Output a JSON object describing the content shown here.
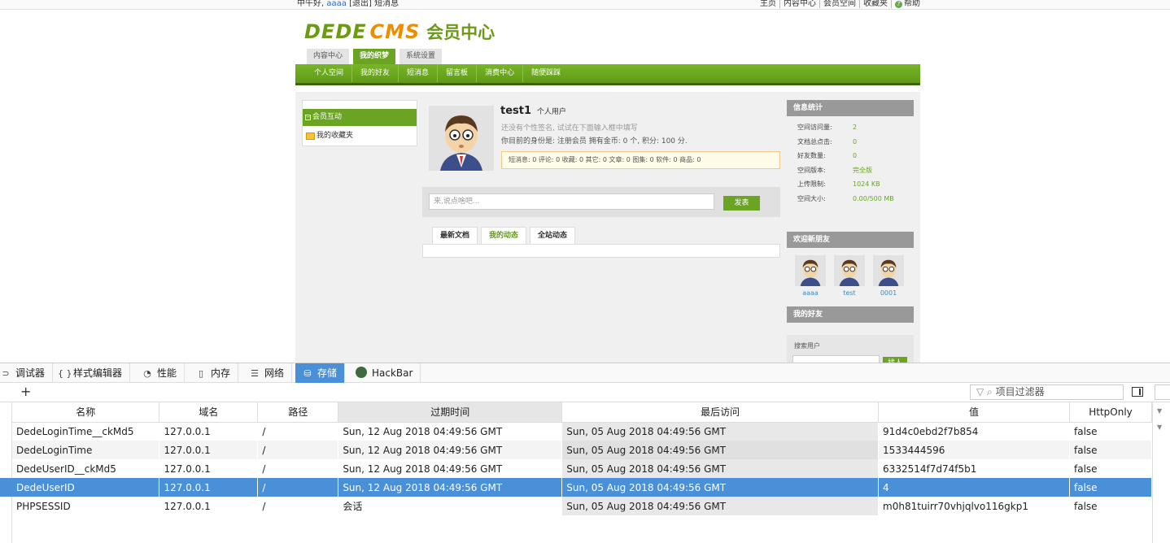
{
  "topbar": {
    "greeting_prefix": "中午好,",
    "username": "aaaa",
    "logout": "[退出]",
    "messages": "短消息",
    "links": [
      "主页",
      "内容中心",
      "会员空间",
      "收藏夹"
    ],
    "help": "帮助"
  },
  "logo": {
    "dede": "DEDE",
    "cms": "CMS",
    "member_center": "会员中心"
  },
  "main_tabs": [
    {
      "label": "内容中心",
      "active": false
    },
    {
      "label": "我的织梦",
      "active": true
    },
    {
      "label": "系统设置",
      "active": false
    }
  ],
  "subnav": [
    "个人空间",
    "我的好友",
    "短消息",
    "留言板",
    "消费中心",
    "随便踩踩"
  ],
  "left_menu": {
    "header": "会员互动",
    "item": "我的收藏夹"
  },
  "profile": {
    "name": "test1",
    "type": "个人用户",
    "signature": "还没有个性签名, 试试在下面输入框中填写",
    "info": "你目前的身份是: 注册会员 拥有金币: 0 个, 积分: 100 分.",
    "stats": "短消息: 0 评论: 0 收藏: 0 其它: 0 文章: 0 图集: 0 软件: 0 商品: 0"
  },
  "post": {
    "placeholder": "来,说点啥吧...",
    "button": "发表"
  },
  "feed_tabs": [
    {
      "label": "最新文档",
      "active": false
    },
    {
      "label": "我的动态",
      "active": true
    },
    {
      "label": "全站动态",
      "active": false
    }
  ],
  "info_stats": {
    "title": "信息统计",
    "rows": [
      {
        "k": "空间访问量:",
        "v": "2"
      },
      {
        "k": "文档总点击:",
        "v": "0"
      },
      {
        "k": "好友数量:",
        "v": "0"
      },
      {
        "k": "空间版本:",
        "v": "完全版"
      },
      {
        "k": "上传限制:",
        "v": "1024 KB"
      },
      {
        "k": "空间大小:",
        "v": "0.00/500 MB"
      }
    ]
  },
  "new_friends": {
    "title": "欢迎新朋友",
    "names": [
      "aaaa",
      "test",
      "0001"
    ]
  },
  "my_friends": {
    "title": "我的好友"
  },
  "search_user": {
    "label": "搜索用户",
    "button": "找人"
  },
  "devtools": {
    "tabs": [
      {
        "label": "调试器",
        "icon": "debugger-icon",
        "glyph": "⊃",
        "active": false
      },
      {
        "label": "样式编辑器",
        "icon": "style-editor-icon",
        "glyph": "{ }",
        "active": false
      },
      {
        "label": "性能",
        "icon": "performance-icon",
        "glyph": "◔",
        "active": false
      },
      {
        "label": "内存",
        "icon": "memory-icon",
        "glyph": "▯",
        "active": false
      },
      {
        "label": "网络",
        "icon": "network-icon",
        "glyph": "☰",
        "active": false
      },
      {
        "label": "存储",
        "icon": "storage-icon",
        "glyph": "⛁",
        "active": true
      },
      {
        "label": "HackBar",
        "icon": "hackbar-icon",
        "glyph": "",
        "active": false
      }
    ],
    "filter_placeholder": "项目过滤器",
    "columns": [
      "名称",
      "域名",
      "路径",
      "过期时间",
      "最后访问",
      "值",
      "HttpOnly"
    ],
    "rows": [
      [
        "DedeLoginTime__ckMd5",
        "127.0.0.1",
        "/",
        "Sun, 12 Aug 2018 04:49:56 GMT",
        "Sun, 05 Aug 2018 04:49:56 GMT",
        "91d4c0ebd2f7b854",
        "false"
      ],
      [
        "DedeLoginTime",
        "127.0.0.1",
        "/",
        "Sun, 12 Aug 2018 04:49:56 GMT",
        "Sun, 05 Aug 2018 04:49:56 GMT",
        "1533444596",
        "false"
      ],
      [
        "DedeUserID__ckMd5",
        "127.0.0.1",
        "/",
        "Sun, 12 Aug 2018 04:49:56 GMT",
        "Sun, 05 Aug 2018 04:49:56 GMT",
        "6332514f7d74f5b1",
        "false"
      ],
      [
        "DedeUserID",
        "127.0.0.1",
        "/",
        "Sun, 12 Aug 2018 04:49:56 GMT",
        "Sun, 05 Aug 2018 04:49:56 GMT",
        "4",
        "false"
      ],
      [
        "PHPSESSID",
        "127.0.0.1",
        "/",
        "会话",
        "Sun, 05 Aug 2018 04:49:56 GMT",
        "m0h81tuirr70vhjqlvo116gkp1",
        "false"
      ]
    ],
    "selected_row": 3
  }
}
